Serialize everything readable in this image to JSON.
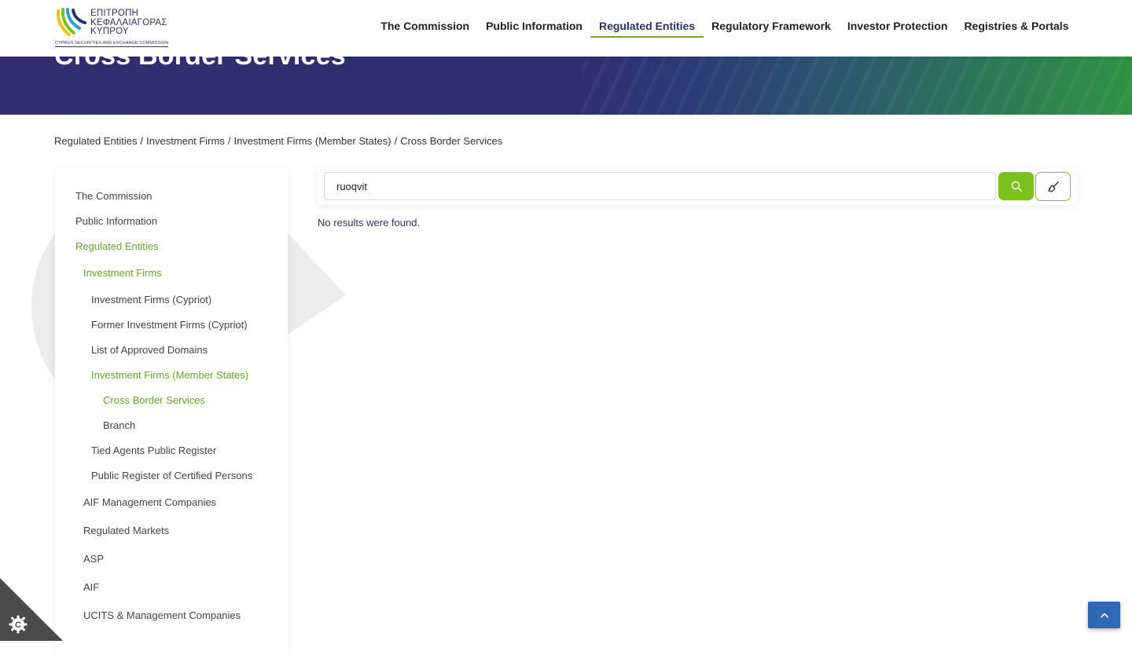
{
  "hero": {
    "title": "Cross Border Services"
  },
  "logo": {
    "line1": "ΕΠΙΤΡΟΠΗ",
    "line2": "ΚΕΦΑΛΑΙΑΓΟΡΑΣ",
    "line3": "ΚΥΠΡΟΥ",
    "sub": "CYPRUS SECURITIES AND EXCHANGE COMMISSION"
  },
  "nav": {
    "items": [
      {
        "label": "The Commission"
      },
      {
        "label": "Public Information"
      },
      {
        "label": "Regulated Entities"
      },
      {
        "label": "Regulatory Framework"
      },
      {
        "label": "Investor Protection"
      },
      {
        "label": "Registries & Portals"
      }
    ],
    "active_index": 2
  },
  "breadcrumb": {
    "items": [
      "Regulated Entities",
      "Investment Firms",
      "Investment Firms (Member States)",
      "Cross Border Services"
    ],
    "separator": "/"
  },
  "sidebar": {
    "items": [
      {
        "label": "The Commission"
      },
      {
        "label": "Public Information"
      },
      {
        "label": "Regulated Entities",
        "active": true
      },
      {
        "label": "Investment Firms",
        "active": true
      },
      {
        "label": "Investment Firms (Cypriot)"
      },
      {
        "label": "Former Investment Firms (Cypriot)"
      },
      {
        "label": "List of Approved Domains"
      },
      {
        "label": "Investment Firms (Member States)",
        "active": true
      },
      {
        "label": "Cross Border Services",
        "active": true
      },
      {
        "label": "Branch"
      },
      {
        "label": "Tied Agents Public Register"
      },
      {
        "label": "Public Register of Certified Persons"
      },
      {
        "label": "AIF Management Companies"
      },
      {
        "label": "Regulated Markets"
      },
      {
        "label": "ASP"
      },
      {
        "label": "AIF"
      },
      {
        "label": "UCITS & Management Companies"
      }
    ]
  },
  "search": {
    "value": "ruoqvit",
    "search_icon": "search-icon",
    "clear_icon": "broom-icon"
  },
  "results": {
    "message": "No results were found."
  },
  "colors": {
    "brand_navy": "#2d2f6d",
    "accent_green": "#7dc11f",
    "active_text": "#6aa61c",
    "back_to_top": "#2f68b4"
  }
}
